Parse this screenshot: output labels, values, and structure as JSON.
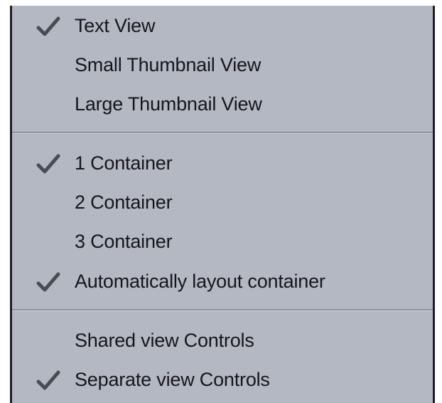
{
  "menu": {
    "groups": [
      {
        "items": [
          {
            "label": "Text View",
            "checked": true
          },
          {
            "label": "Small Thumbnail View",
            "checked": false
          },
          {
            "label": "Large Thumbnail View",
            "checked": false
          }
        ]
      },
      {
        "items": [
          {
            "label": "1 Container",
            "checked": true
          },
          {
            "label": "2 Container",
            "checked": false
          },
          {
            "label": "3 Container",
            "checked": false
          },
          {
            "label": "Automatically layout container",
            "checked": true
          }
        ]
      },
      {
        "items": [
          {
            "label": "Shared view Controls",
            "checked": false
          },
          {
            "label": "Separate view Controls",
            "checked": true
          }
        ]
      }
    ],
    "icons": {
      "check": "checkmark-icon"
    },
    "colors": {
      "background": "#b4b8c3",
      "text": "#16161a",
      "separator": "#8e929c",
      "border": "#1f1f22"
    }
  }
}
